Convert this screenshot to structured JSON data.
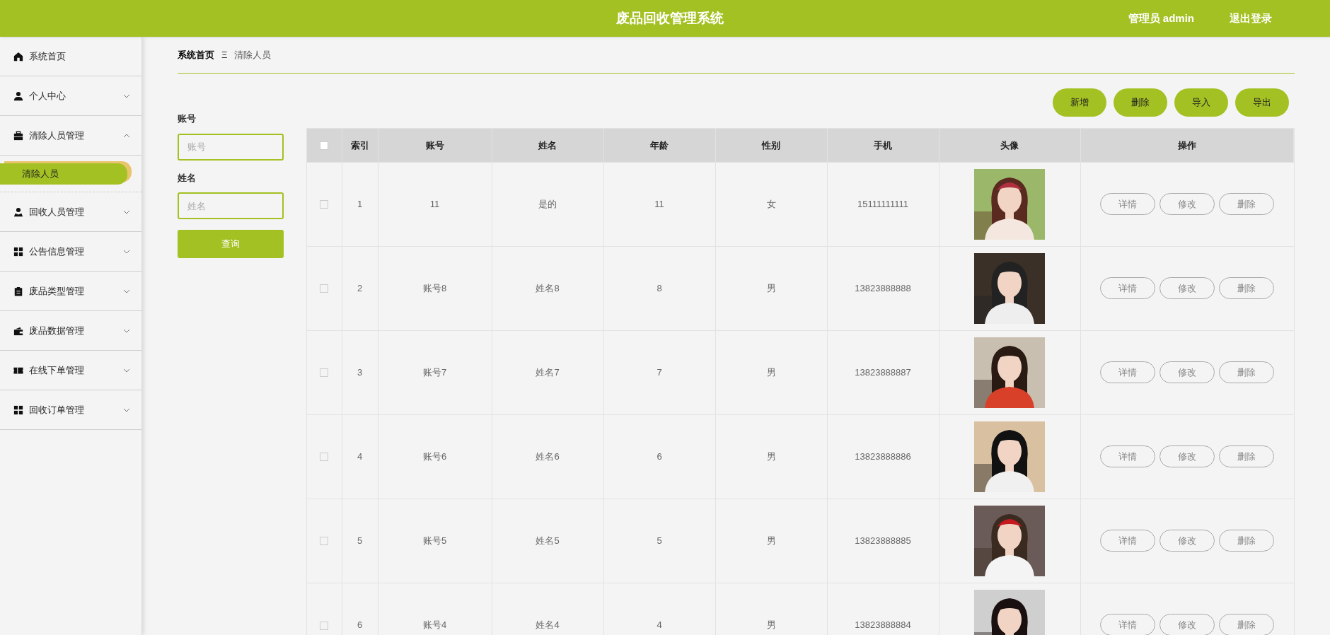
{
  "header": {
    "title": "废品回收管理系统",
    "user": "管理员 admin",
    "logout": "退出登录"
  },
  "sidebar": {
    "items": [
      {
        "label": "系统首页",
        "kind": "link"
      },
      {
        "label": "个人中心",
        "kind": "group",
        "expanded": false
      },
      {
        "label": "清除人员管理",
        "kind": "group",
        "expanded": true,
        "children": [
          {
            "label": "清除人员",
            "selected": true
          }
        ]
      },
      {
        "label": "回收人员管理",
        "kind": "group",
        "expanded": false
      },
      {
        "label": "公告信息管理",
        "kind": "group",
        "expanded": false
      },
      {
        "label": "废品类型管理",
        "kind": "group",
        "expanded": false
      },
      {
        "label": "废品数据管理",
        "kind": "group",
        "expanded": false
      },
      {
        "label": "在线下单管理",
        "kind": "group",
        "expanded": false
      },
      {
        "label": "回收订单管理",
        "kind": "group",
        "expanded": false
      }
    ]
  },
  "breadcrumb": {
    "home": "系统首页",
    "separator": "Ξ",
    "current": "清除人员"
  },
  "search": {
    "fields": [
      {
        "label": "账号",
        "placeholder": "账号"
      },
      {
        "label": "姓名",
        "placeholder": "姓名"
      }
    ],
    "button": "查询"
  },
  "actions": [
    "新增",
    "删除",
    "导入",
    "导出"
  ],
  "table": {
    "select_all": {
      "checked": false
    },
    "columns": [
      "索引",
      "账号",
      "姓名",
      "年龄",
      "性别",
      "手机",
      "头像",
      "操作"
    ],
    "rows": [
      {
        "checked": false,
        "cells": [
          "1",
          "11",
          "是的",
          "11",
          "女",
          "15111111111"
        ],
        "avatar": {
          "kind": "picture"
        },
        "buttons": [
          "详情",
          "修改",
          "删除"
        ]
      },
      {
        "checked": false,
        "cells": [
          "2",
          "账号8",
          "姓名8",
          "8",
          "男",
          "13823888888"
        ],
        "avatar": {
          "kind": "picture"
        },
        "buttons": [
          "详情",
          "修改",
          "删除"
        ]
      },
      {
        "checked": false,
        "cells": [
          "3",
          "账号7",
          "姓名7",
          "7",
          "男",
          "13823888887"
        ],
        "avatar": {
          "kind": "picture"
        },
        "buttons": [
          "详情",
          "修改",
          "删除"
        ]
      },
      {
        "checked": false,
        "cells": [
          "4",
          "账号6",
          "姓名6",
          "6",
          "男",
          "13823888886"
        ],
        "avatar": {
          "kind": "picture"
        },
        "buttons": [
          "详情",
          "修改",
          "删除"
        ]
      },
      {
        "checked": false,
        "cells": [
          "5",
          "账号5",
          "姓名5",
          "5",
          "男",
          "13823888885"
        ],
        "avatar": {
          "kind": "picture"
        },
        "buttons": [
          "详情",
          "修改",
          "删除"
        ]
      },
      {
        "checked": false,
        "cells": [
          "6",
          "账号4",
          "姓名4",
          "4",
          "男",
          "13823888884"
        ],
        "avatar": {
          "kind": "picture"
        },
        "buttons": [
          "详情",
          "修改",
          "删除"
        ]
      }
    ]
  }
}
